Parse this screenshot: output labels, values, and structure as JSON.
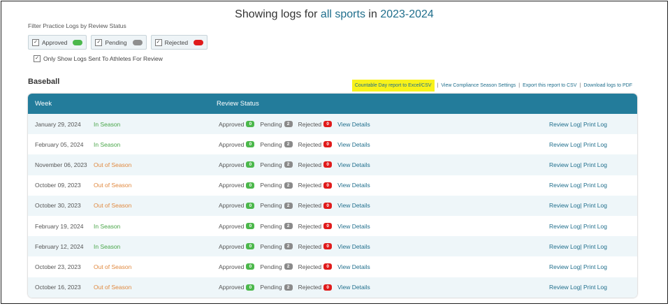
{
  "header": {
    "prefix": "Showing logs for",
    "sport_scope": "all sports",
    "in_word": "in",
    "season": "2023-2024"
  },
  "filters": {
    "label": "Filter Practice Logs by Review Status",
    "chips": [
      {
        "label": "Approved",
        "checked": "✓",
        "color": "#4cb84c"
      },
      {
        "label": "Pending",
        "checked": "✓",
        "color": "#8f8f8f"
      },
      {
        "label": "Rejected",
        "checked": "✓",
        "color": "#e01b1b"
      }
    ],
    "only_show": {
      "label": "Only Show Logs Sent To Athletes For Review",
      "checked": "✓"
    }
  },
  "section": {
    "sport": "Baseball",
    "links": {
      "countable": "Countable Day report to Excel/CSV",
      "compliance": "View Compliance Season Settings",
      "export": "Export this report to CSV",
      "download": "Download logs to PDF",
      "separator": "|"
    }
  },
  "table": {
    "headers": {
      "week": "Week",
      "status": "Review Status"
    },
    "status_labels": {
      "approved": "Approved",
      "pending": "Pending",
      "rejected": "Rejected"
    },
    "view_details": "View Details",
    "review_log": "Review Log",
    "print_log": "Print Log",
    "action_sep": "|",
    "rows": [
      {
        "week": "January 29, 2024",
        "season": "In Season",
        "approved": "0",
        "pending": "2",
        "rejected": "0"
      },
      {
        "week": "February 05, 2024",
        "season": "In Season",
        "approved": "0",
        "pending": "2",
        "rejected": "0"
      },
      {
        "week": "November 06, 2023",
        "season": "Out of Season",
        "approved": "0",
        "pending": "2",
        "rejected": "0"
      },
      {
        "week": "October 09, 2023",
        "season": "Out of Season",
        "approved": "0",
        "pending": "2",
        "rejected": "0"
      },
      {
        "week": "October 30, 2023",
        "season": "Out of Season",
        "approved": "0",
        "pending": "2",
        "rejected": "0"
      },
      {
        "week": "February 19, 2024",
        "season": "In Season",
        "approved": "0",
        "pending": "2",
        "rejected": "0"
      },
      {
        "week": "February 12, 2024",
        "season": "In Season",
        "approved": "0",
        "pending": "2",
        "rejected": "0"
      },
      {
        "week": "October 23, 2023",
        "season": "Out of Season",
        "approved": "0",
        "pending": "2",
        "rejected": "0"
      },
      {
        "week": "October 16, 2023",
        "season": "Out of Season",
        "approved": "0",
        "pending": "2",
        "rejected": "0"
      }
    ]
  }
}
